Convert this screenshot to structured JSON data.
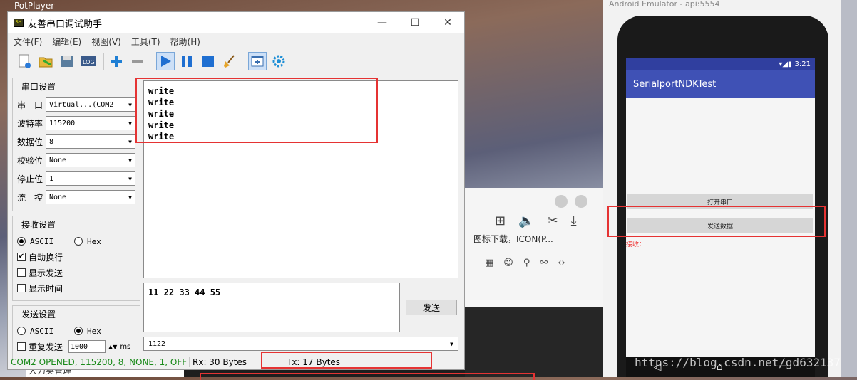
{
  "desktop": {
    "taskbar_label": "PotPlayer",
    "partial_label": "大力奥管理"
  },
  "serial": {
    "title": "友善串口调试助手",
    "window_controls": [
      "—",
      "☐",
      "✕"
    ],
    "menu": [
      "文件(F)",
      "编辑(E)",
      "视图(V)",
      "工具(T)",
      "帮助(H)"
    ],
    "port_settings": {
      "title": "串口设置",
      "rows": [
        {
          "label": "串　口",
          "value": "Virtual...(COM2"
        },
        {
          "label": "波特率",
          "value": "115200"
        },
        {
          "label": "数据位",
          "value": "8"
        },
        {
          "label": "校验位",
          "value": "None"
        },
        {
          "label": "停止位",
          "value": "1"
        },
        {
          "label": "流　控",
          "value": "None"
        }
      ]
    },
    "recv_settings": {
      "title": "接收设置",
      "ascii": "ASCII",
      "hex": "Hex",
      "auto_wrap": "自动换行",
      "show_send": "显示发送",
      "show_time": "显示时间"
    },
    "send_settings": {
      "title": "发送设置",
      "ascii": "ASCII",
      "hex": "Hex",
      "repeat": "重复发送",
      "interval": "1000",
      "unit": "ms"
    },
    "recv_lines": [
      "write",
      "write",
      "write",
      "write",
      "write"
    ],
    "send_text": "11 22 33 44 55",
    "send_button": "发送",
    "history_value": "1122",
    "status": {
      "port": "COM2 OPENED, 115200, 8, NONE, 1, OFF",
      "rx": "Rx: 30 Bytes",
      "tx": "Tx: 17 Bytes"
    }
  },
  "background_window": {
    "line": "图标下载，ICON(P..."
  },
  "emulator": {
    "window_title": "Android Emulator - api:5554",
    "time": "3:21",
    "app_title": "SerialportNDKTest",
    "open_button": "打开串口",
    "send_button": "发送数据",
    "recv_label": "接收：",
    "watermark": "https://blog.csdn.net/gd6321374"
  }
}
